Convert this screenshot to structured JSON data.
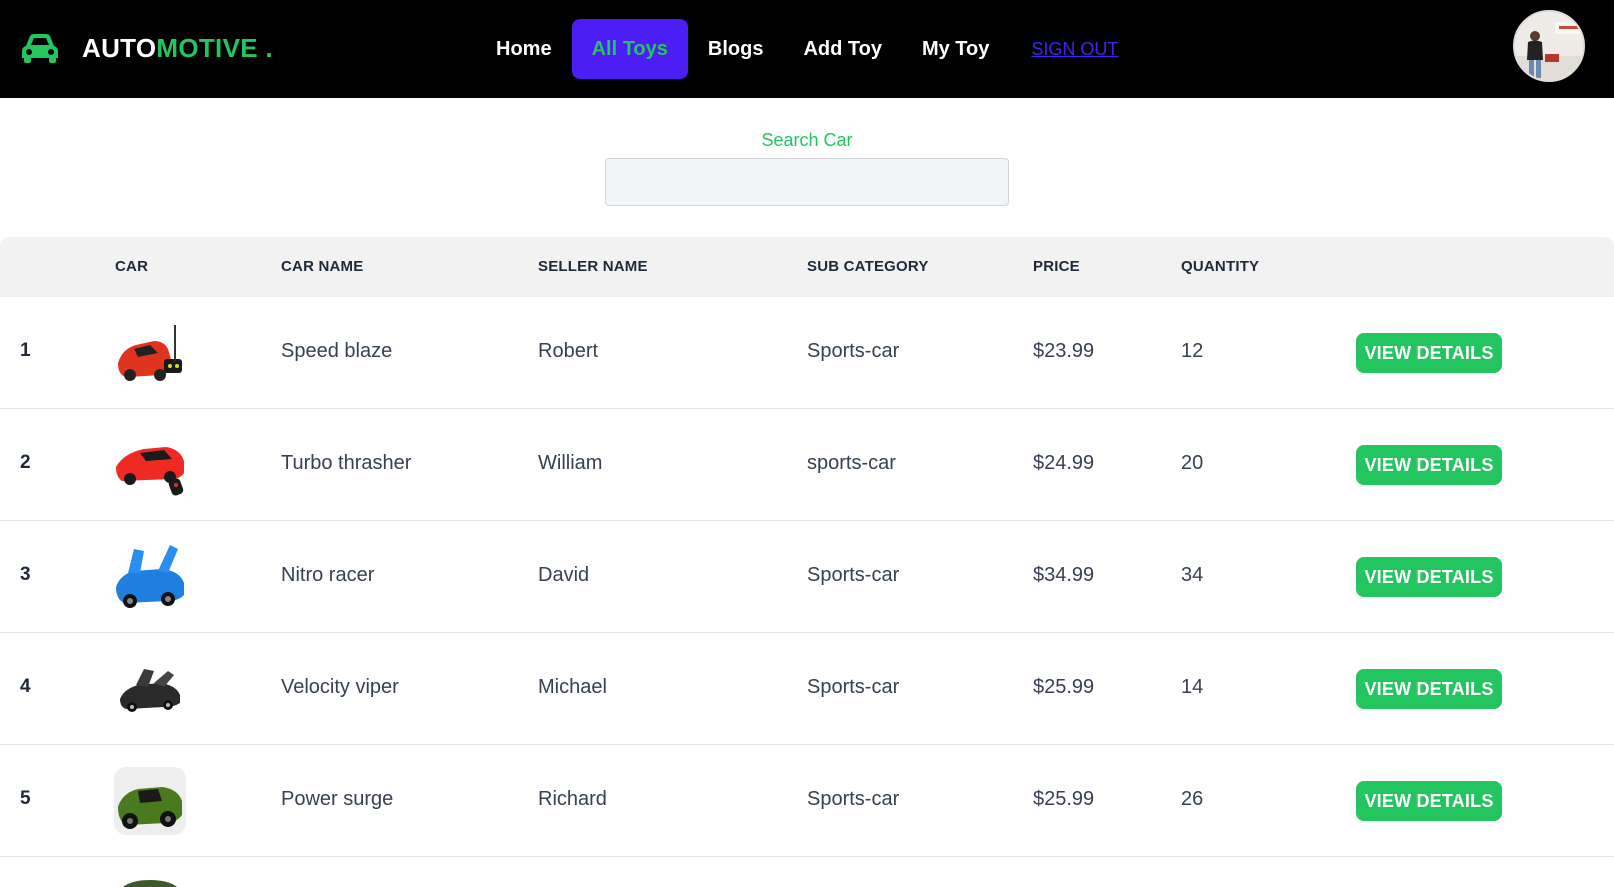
{
  "brand": {
    "prefix": "AUTO",
    "accent_text": "MOTIVE .",
    "logo_icon": "car-front-icon",
    "accent_color": "#22c55e"
  },
  "nav": {
    "items": [
      {
        "label": "Home",
        "active": false
      },
      {
        "label": "All Toys",
        "active": true
      },
      {
        "label": "Blogs",
        "active": false
      },
      {
        "label": "Add Toy",
        "active": false
      },
      {
        "label": "My Toy",
        "active": false
      }
    ],
    "signout_label": "SIGN OUT",
    "active_bg": "#4c1df5"
  },
  "avatar": {
    "icon": "user-avatar-photo"
  },
  "search": {
    "label": "Search Car",
    "value": "",
    "placeholder": ""
  },
  "table": {
    "headers": [
      "",
      "CAR",
      "CAR NAME",
      "SELLER NAME",
      "SUB CATEGORY",
      "PRICE",
      "QUANTITY",
      ""
    ],
    "button_label": "VIEW DETAILS",
    "rows": [
      {
        "index": "1",
        "car_name": "Speed blaze",
        "seller": "Robert",
        "sub_category": "Sports-car",
        "price": "$23.99",
        "quantity": "12",
        "thumb_color": "#e0341f"
      },
      {
        "index": "2",
        "car_name": "Turbo thrasher",
        "seller": "William",
        "sub_category": "sports-car",
        "price": "$24.99",
        "quantity": "20",
        "thumb_color": "#ef2a22"
      },
      {
        "index": "3",
        "car_name": "Nitro racer",
        "seller": "David",
        "sub_category": "Sports-car",
        "price": "$34.99",
        "quantity": "34",
        "thumb_color": "#1e7fe0"
      },
      {
        "index": "4",
        "car_name": "Velocity viper",
        "seller": "Michael",
        "sub_category": "Sports-car",
        "price": "$25.99",
        "quantity": "14",
        "thumb_color": "#2a2a2a"
      },
      {
        "index": "5",
        "car_name": "Power surge",
        "seller": "Richard",
        "sub_category": "Sports-car",
        "price": "$25.99",
        "quantity": "26",
        "thumb_color": "#4a7a1e"
      }
    ]
  }
}
